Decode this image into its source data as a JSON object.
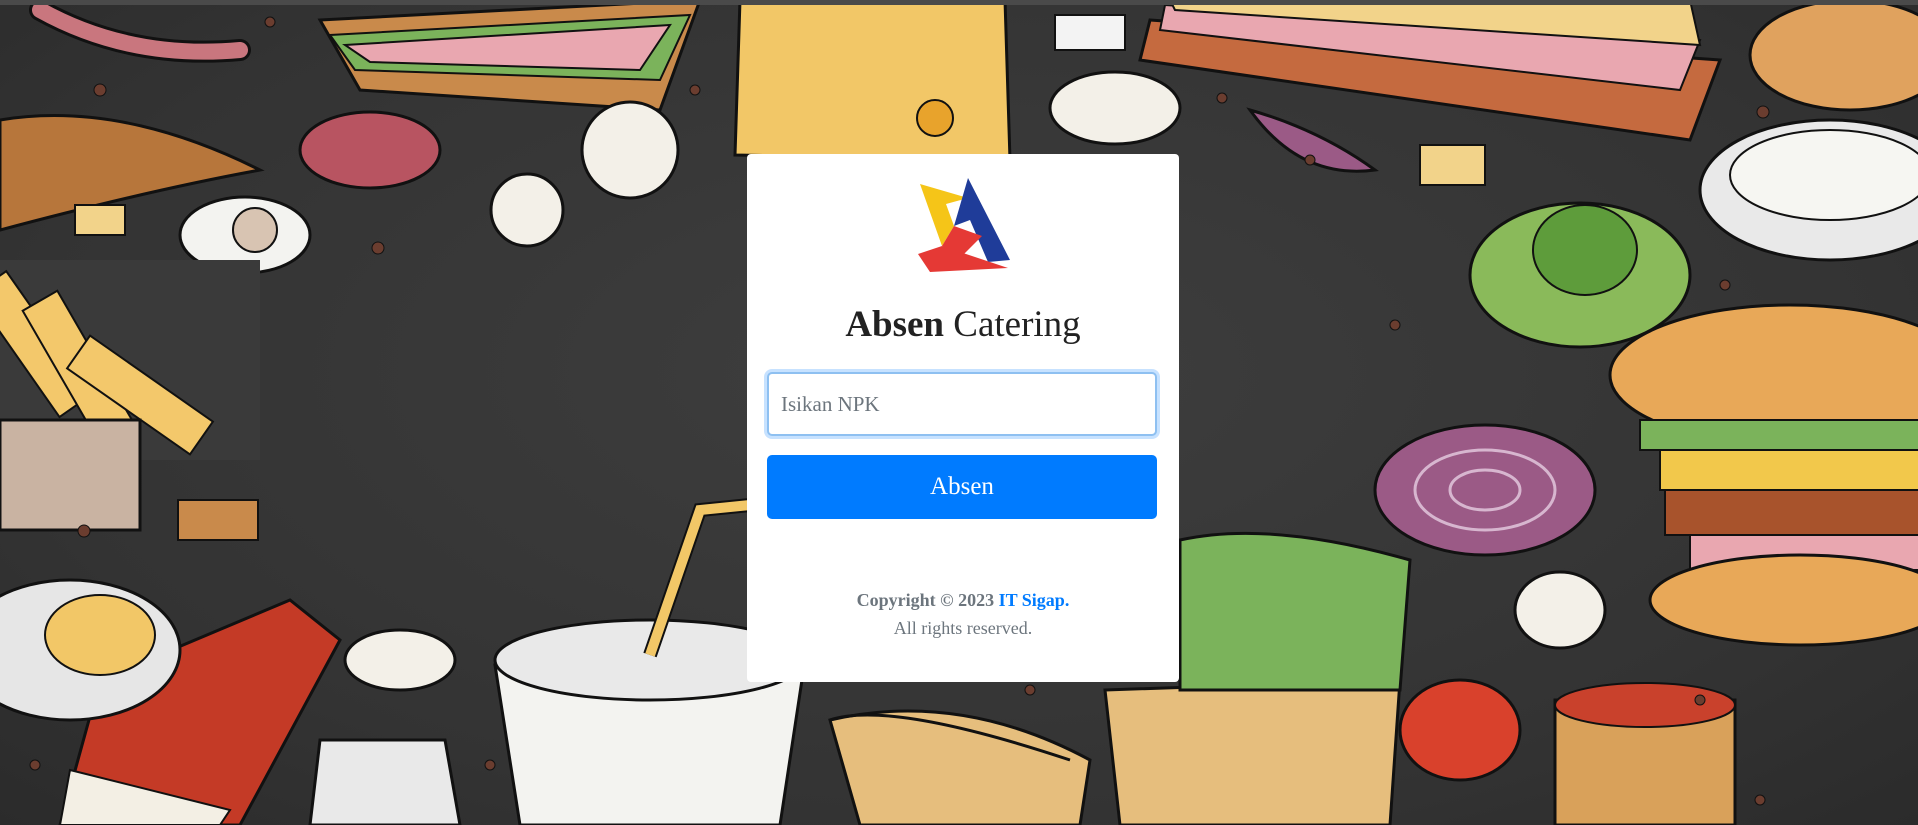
{
  "app": {
    "title_bold": "Absen",
    "title_rest": "Catering"
  },
  "form": {
    "npk_placeholder": "Isikan NPK",
    "npk_value": "",
    "submit_label": "Absen"
  },
  "footer": {
    "copyright_prefix": "Copyright © 2023",
    "company_link": "IT Sigap",
    "period": ".",
    "rights": "All rights reserved."
  },
  "colors": {
    "primary": "#007bff",
    "background": "#3a3a3a",
    "card": "#ffffff",
    "logo_yellow": "#f5c518",
    "logo_blue": "#1f3c99",
    "logo_red": "#e53935"
  },
  "icons": {
    "logo": "tricolor-triangle-logo"
  }
}
